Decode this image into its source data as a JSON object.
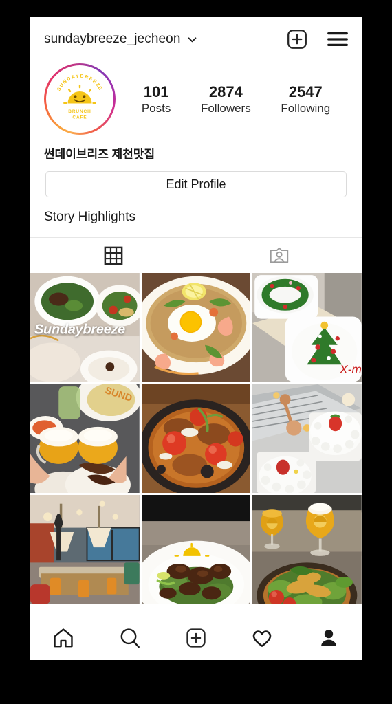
{
  "header": {
    "username": "sundaybreeze_jecheon",
    "chevron_icon": "chevron-down-icon",
    "add_icon": "plus-square-icon",
    "menu_icon": "hamburger-menu-icon"
  },
  "profile": {
    "avatar_alt": "sundaybreeze-brunch-cafe-logo",
    "avatar_logo_text_top": "SUNDAYBREEZE",
    "avatar_logo_text_bottom_1": "BRUNCH",
    "avatar_logo_text_bottom_2": "CAFE",
    "bio": "썬데이브리즈 제천맛집",
    "edit_profile_label": "Edit Profile",
    "story_highlights_label": "Story Highlights",
    "has_story_ring": true,
    "stats": [
      {
        "value": "101",
        "label": "Posts"
      },
      {
        "value": "2874",
        "label": "Followers"
      },
      {
        "value": "2547",
        "label": "Following"
      }
    ]
  },
  "tabs": [
    {
      "name": "grid-tab",
      "icon": "grid-icon",
      "active": true
    },
    {
      "name": "tagged-tab",
      "icon": "tagged-person-icon",
      "active": false
    }
  ],
  "grid": {
    "posts": [
      {
        "name": "post-salad-plates",
        "caption_overlay": "Sundaybreeze",
        "description": "beef and greens salad plates on marble table"
      },
      {
        "name": "post-shrimp-fried-rice",
        "caption_overlay": "",
        "description": "shrimp fried rice with fried egg and lemon"
      },
      {
        "name": "post-christmas-cakes",
        "caption_overlay": "",
        "description": "christmas tree decorated cakes in boxes, X-mas icing"
      },
      {
        "name": "post-beer-cheers",
        "caption_overlay": "",
        "description": "two hands toasting beer glasses over food"
      },
      {
        "name": "post-tomato-skillet",
        "caption_overlay": "",
        "description": "skillet dish with roasted tomatoes and cheese"
      },
      {
        "name": "post-strawberry-cakes",
        "caption_overlay": "",
        "description": "white cream cakes with strawberries in display case"
      },
      {
        "name": "post-cafe-interior",
        "caption_overlay": "",
        "description": "cafe interior with chandeliers and wooden tables"
      },
      {
        "name": "post-beef-skewers",
        "caption_overlay": "",
        "description": "grilled beef with greens on white plate"
      },
      {
        "name": "post-beer-and-salad",
        "caption_overlay": "",
        "description": "two logo beer glasses with chicken salad bowl"
      }
    ]
  },
  "bottom_nav": [
    {
      "name": "nav-home",
      "icon": "home-icon",
      "active": false
    },
    {
      "name": "nav-search",
      "icon": "search-icon",
      "active": false
    },
    {
      "name": "nav-create",
      "icon": "plus-square-icon",
      "active": false
    },
    {
      "name": "nav-activity",
      "icon": "heart-icon",
      "active": false
    },
    {
      "name": "nav-profile",
      "icon": "person-icon",
      "active": true
    }
  ],
  "colors": {
    "accent_gradient_start": "#f9a03c",
    "accent_gradient_mid": "#e1306c",
    "accent_gradient_end": "#833ab4",
    "logo_yellow": "#f5c518",
    "text_primary": "#1a1a1a",
    "border": "#dbdbdb"
  }
}
